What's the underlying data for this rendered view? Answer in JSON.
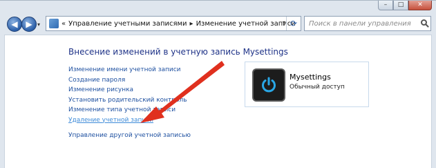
{
  "window": {
    "caption_min": "–",
    "caption_max": "□",
    "caption_close": "✕"
  },
  "toolbar": {
    "back_icon": "◀",
    "forward_icon": "▶",
    "breadcrumb": {
      "prefix": "«",
      "items": [
        "Управление учетными записями",
        "Изменение учетной записи"
      ],
      "separator": "▸"
    },
    "search_placeholder": "Поиск в панели управления"
  },
  "main": {
    "heading": "Внесение изменений в учетную запись Mysettings",
    "links": [
      "Изменение имени учетной записи",
      "Создание пароля",
      "Изменение рисунка",
      "Установить родительский контроль",
      "Изменение типа учетной записи",
      "Удаление учетной записи"
    ],
    "other_link": "Управление другой учетной записью"
  },
  "account": {
    "name": "Mysettings",
    "type": "Обычный доступ",
    "avatar_icon": "power-icon"
  },
  "colors": {
    "link": "#1e50a0",
    "link_hover": "#3c8ad8",
    "heading": "#1e3287",
    "arrow": "#e0301e",
    "power_glow": "#29a7e6"
  }
}
